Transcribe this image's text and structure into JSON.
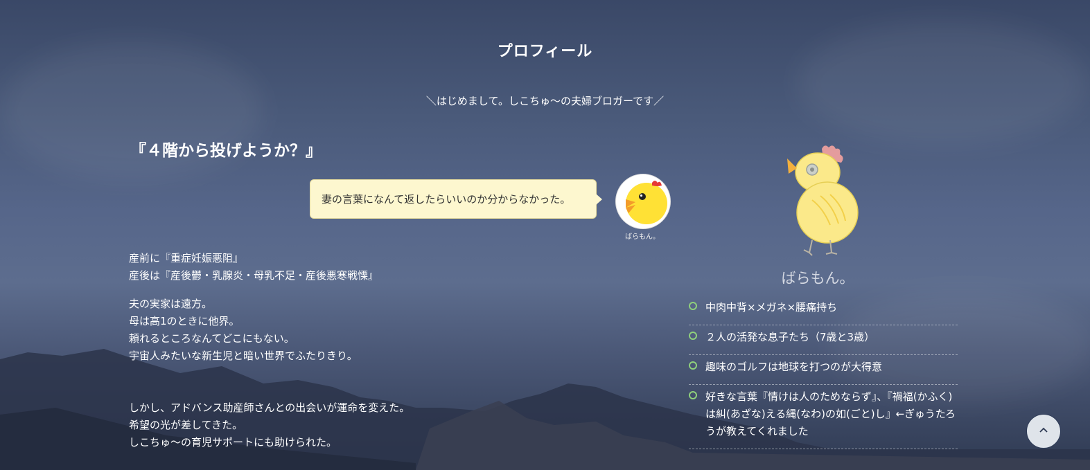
{
  "page": {
    "title": "プロフィール",
    "subtitle": "＼はじめまして。しこちゅ〜の夫婦ブロガーです／"
  },
  "story": {
    "heading": "『４階から投げようか？』",
    "speech_bubble": {
      "text": "妻の言葉になんて返したらいいのか分からなかった。",
      "speaker_name": "ばらもん。",
      "speaker_icon": "chick-avatar-icon"
    },
    "paragraphs": [
      {
        "lines": [
          "産前に『重症妊娠悪阻』",
          "産後は『産後鬱・乳腺炎・母乳不足・産後悪寒戦慄』"
        ]
      },
      {
        "lines": [
          "夫の実家は遠方。",
          "母は高1のときに他界。",
          "頼れるところなんてどこにもない。",
          "宇宙人みたいな新生児と暗い世界でふたりきり。"
        ]
      },
      {
        "lines": [
          "しかし、アドバンス助産師さんとの出会いが運命を変えた。",
          "希望の光が差してきた。",
          "しこちゅ〜の育児サポートにも助けられた。"
        ]
      }
    ]
  },
  "profile": {
    "name": "ばらもん。",
    "mascot_icon": "chick-mascot-icon",
    "items": [
      {
        "text": "中肉中背×メガネ×腰痛持ち"
      },
      {
        "text": "２人の活発な息子たち（7歳と3歳）"
      },
      {
        "text": "趣味のゴルフは地球を打つのが大得意"
      },
      {
        "text": "好きな言葉『情けは人のためならず』、『禍福(かふく)は糾(あざな)える縄(なわ)の如(ごと)し』←ぎゅうたろうが教えてくれました"
      }
    ]
  },
  "scroll_top": {
    "label": "^",
    "icon": "chevron-up-icon"
  },
  "colors": {
    "bubble_bg": "#fdf7cf",
    "bullet": "#8fd07c",
    "chick_yellow": "#ffe135"
  }
}
